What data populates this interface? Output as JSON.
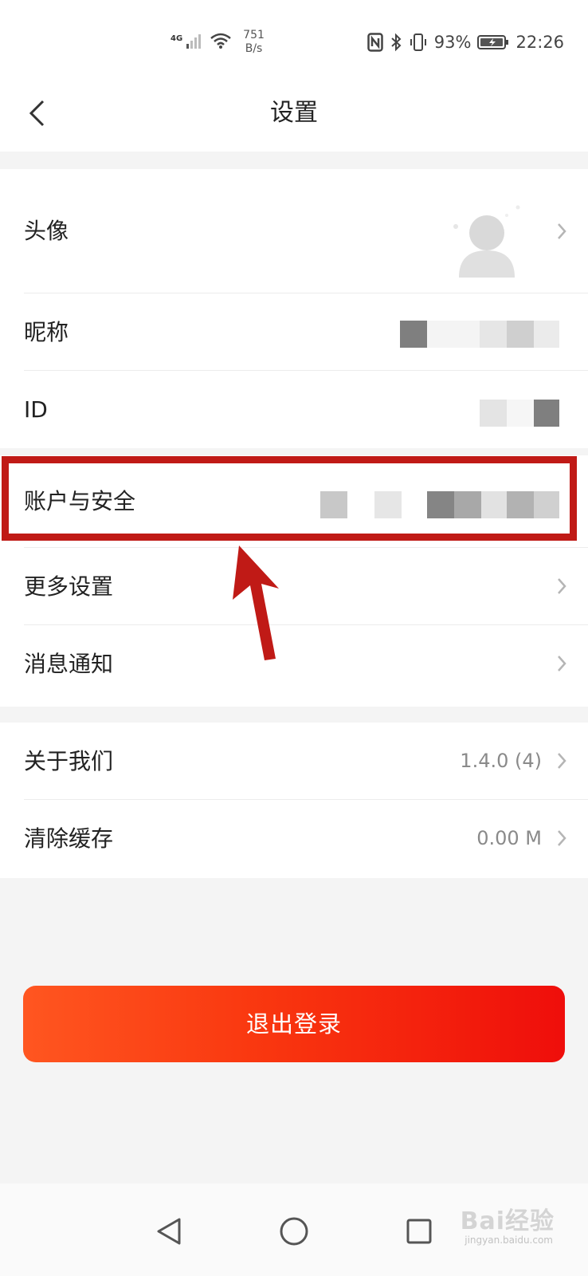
{
  "status_bar": {
    "network": "4G",
    "speed_value": "751",
    "speed_unit": "B/s",
    "battery": "93%",
    "time": "22:26"
  },
  "header": {
    "title": "设置"
  },
  "profile": {
    "avatar_label": "头像",
    "nickname_label": "昵称",
    "id_label": "ID"
  },
  "settings": {
    "account_label": "账户与安全",
    "more_label": "更多设置",
    "notify_label": "消息通知"
  },
  "about": {
    "about_label": "关于我们",
    "version": "1.4.0 (4)",
    "cache_label": "清除缓存",
    "cache_size": "0.00 M"
  },
  "logout_label": "退出登录",
  "watermark": {
    "brand": "Bai经验",
    "url": "jingyan.baidu.com"
  },
  "colors": {
    "accent": "#c01a16",
    "logout_start": "#ff5620",
    "logout_end": "#ef0e0b"
  }
}
